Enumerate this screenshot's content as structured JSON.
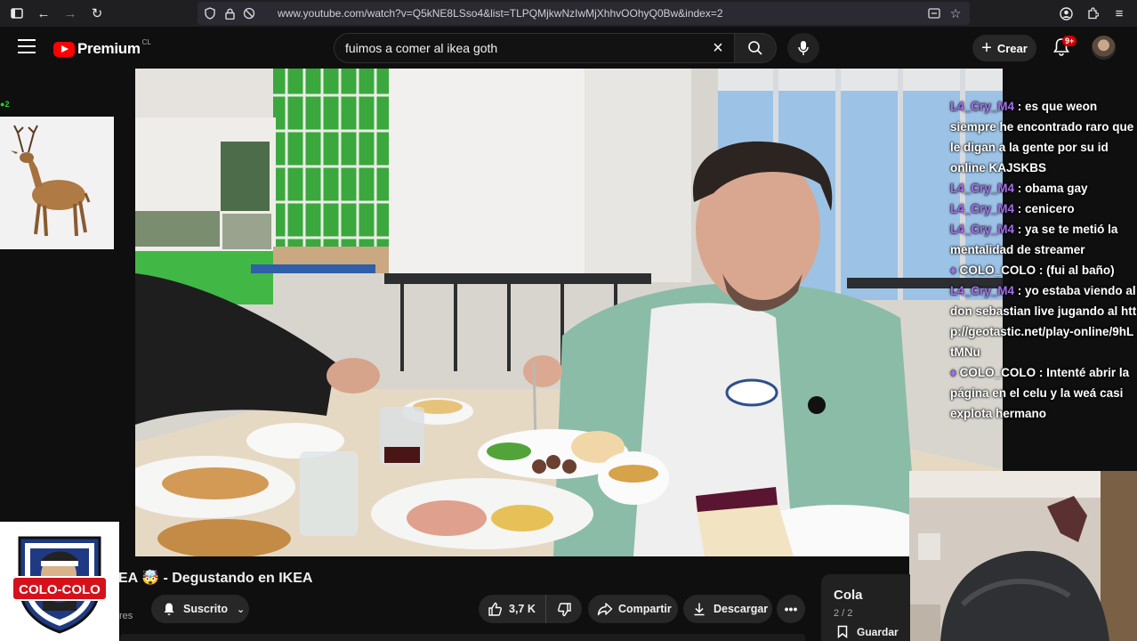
{
  "browser": {
    "url": "www.youtube.com/watch?v=Q5kNE8LSso4&list=TLPQMjkwNzIwMjXhhvOOhyQ0Bw&index=2"
  },
  "header": {
    "logo_text": "Premium",
    "logo_sup": "CL",
    "search_query": "fuimos a comer al ikea goth",
    "create_label": "Crear",
    "notification_badge": "9+"
  },
  "overlay": {
    "small_counter": "2",
    "logo_text": "COLO-COLO"
  },
  "chat": [
    {
      "user": "L4_Cry_M4",
      "text": " : es que weon siempre he encontrado raro que le digan a la gente por su id online KAJSKBS"
    },
    {
      "user": "L4_Cry_M4",
      "text": " : obama gay"
    },
    {
      "user": "L4_Cry_M4",
      "text": " : cenicero"
    },
    {
      "user": "L4_Cry_M4",
      "text": " : ya se te metió la mentalidad de streamer"
    },
    {
      "user": "COLO_COLO",
      "text": " : (fui al baño)",
      "pinned": true
    },
    {
      "user": "L4_Cry_M4",
      "text": " : yo estaba viendo al don sebastian live jugando al http://geotastic.net/play-online/9hLtMNu"
    },
    {
      "user": "COLO_COLO",
      "text": " : Intenté abrir la página en el celu y la weá casi explota hermano",
      "pinned": true
    }
  ],
  "video": {
    "title": "EA 🤯 - Degustando en IKEA",
    "channel_fade": "res"
  },
  "actions": {
    "subscribe": "Suscrito",
    "likes": "3,7 K",
    "share": "Compartir",
    "download": "Descargar"
  },
  "playlist": {
    "title": "Cola",
    "count": "2 / 2",
    "save": "Guardar"
  },
  "colors": {
    "youtube_red": "#ff0000",
    "chat_user": "#a66cf0",
    "pill_bg": "#272727"
  }
}
